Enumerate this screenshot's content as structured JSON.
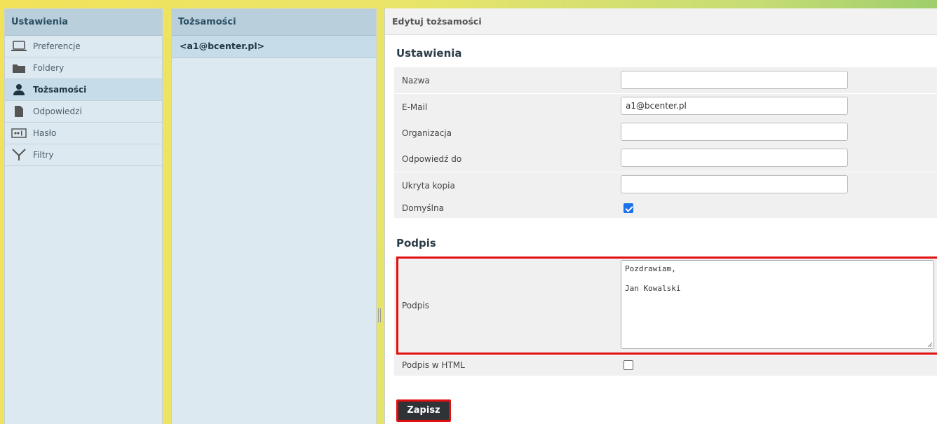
{
  "sidebar": {
    "title": "Ustawienia",
    "items": [
      {
        "label": "Preferencje",
        "icon": "laptop-icon"
      },
      {
        "label": "Foldery",
        "icon": "folder-icon"
      },
      {
        "label": "Tożsamości",
        "icon": "user-icon"
      },
      {
        "label": "Odpowiedzi",
        "icon": "document-icon"
      },
      {
        "label": "Hasło",
        "icon": "password-icon"
      },
      {
        "label": "Filtry",
        "icon": "filter-icon"
      }
    ],
    "active": "Tożsamości"
  },
  "identities": {
    "title": "Tożsamości",
    "items": [
      "<a1@bcenter.pl>"
    ]
  },
  "edit": {
    "header": "Edytuj tożsamości",
    "settings_title": "Ustawienia",
    "fields": {
      "name": {
        "label": "Nazwa",
        "value": ""
      },
      "email": {
        "label": "E-Mail",
        "value": "a1@bcenter.pl"
      },
      "organization": {
        "label": "Organizacja",
        "value": ""
      },
      "reply_to": {
        "label": "Odpowiedź do",
        "value": ""
      },
      "bcc": {
        "label": "Ukryta kopia",
        "value": ""
      },
      "default": {
        "label": "Domyślna",
        "checked": true
      }
    },
    "signature_title": "Podpis",
    "signature": {
      "label": "Podpis",
      "value": "Pozdrawiam,\n\nJan Kowalski"
    },
    "html_signature": {
      "label": "Podpis w HTML",
      "checked": false
    },
    "save_label": "Zapisz"
  },
  "colors": {
    "accent": "#1a73e8",
    "highlight": "#e01010",
    "header_bg": "#b9cfdc",
    "button_bg": "#2f3338"
  }
}
